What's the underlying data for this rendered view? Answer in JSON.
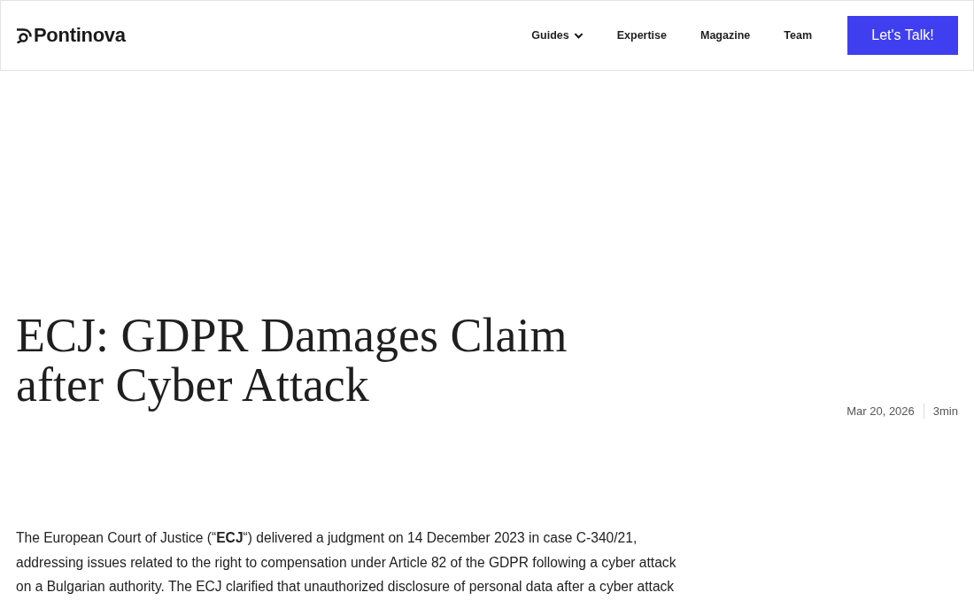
{
  "header": {
    "logo": "Pontinova",
    "nav": [
      {
        "label": "Guides",
        "dropdown": true
      },
      {
        "label": "Expertise",
        "dropdown": false
      },
      {
        "label": "Magazine",
        "dropdown": false
      },
      {
        "label": "Team",
        "dropdown": false
      }
    ],
    "cta": "Let's Talk!"
  },
  "article": {
    "title": "ECJ: GDPR Damages Claim after Cyber Attack",
    "date": "Mar 20, 2026",
    "read_time": "3min",
    "body": "The European Court of Justice (“**ECJ**“) delivered a judgment on 14 December 2023 in case C-340/21, addressing issues related to the right to compensation under Article 82 of the GDPR following a cyber attack on a Bulgarian authority. The ECJ clarified that unauthorized disclosure of personal data after a cyber attack"
  }
}
